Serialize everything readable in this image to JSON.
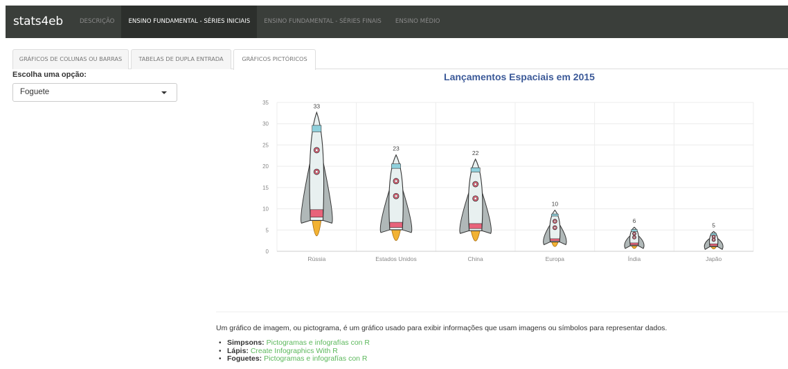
{
  "navbar": {
    "brand": "stats4eb",
    "items": [
      {
        "label": "DESCRIÇÃO"
      },
      {
        "label": "ENSINO FUNDAMENTAL - SÉRIES INICIAIS"
      },
      {
        "label": "ENSINO FUNDAMENTAL - SÉRIES FINAIS"
      },
      {
        "label": "ENSINO MÉDIO"
      }
    ]
  },
  "tabs": [
    {
      "label": "GRÁFICOS DE COLUNAS OU BARRAS"
    },
    {
      "label": "TABELAS DE DUPLA ENTRADA"
    },
    {
      "label": "GRÁFICOS PICTÓRICOS"
    }
  ],
  "sidebar": {
    "label": "Escolha uma opção:",
    "selected": "Foguete"
  },
  "chart_data": {
    "type": "bar",
    "title": "Lançamentos Espaciais em 2015",
    "categories": [
      "Rússia",
      "Estados Unidos",
      "China",
      "Europa",
      "Índia",
      "Japão"
    ],
    "values": [
      33,
      23,
      22,
      10,
      6,
      5
    ],
    "ylim": [
      0,
      35
    ],
    "yticks": [
      0,
      5,
      10,
      15,
      20,
      25,
      30,
      35
    ],
    "grid": true,
    "mark": "rocket-pictogram"
  },
  "footer": {
    "description": "Um gráfico de imagem, ou pictograma, é um gráfico usado para exibir informações que usam imagens ou símbolos para representar dados.",
    "links": [
      {
        "name": "Simpsons:",
        "text": "Pictogramas e infografías con R"
      },
      {
        "name": "Lápis:",
        "text": "Create Infographics With R"
      },
      {
        "name": "Foguetes:",
        "text": "Pictogramas e infografías con R"
      }
    ]
  },
  "colors": {
    "navbar_bg": "#3a3e3a",
    "title": "#3b5998",
    "link": "#5cb85c",
    "rocket_body": "#e8f0f0",
    "rocket_accent": "#8fd0dc",
    "rocket_fins": "#b0b8b8",
    "rocket_band": "#e8637a",
    "flame": "#f2b233"
  }
}
